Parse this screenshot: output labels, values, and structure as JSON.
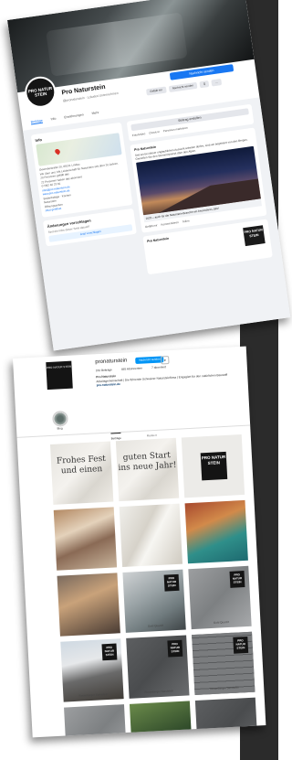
{
  "facebook": {
    "page_name": "Pro Naturstein",
    "handle": "@pronaturstein · Lokales Unternehmen",
    "avatar_text": "PRO NATUR STEIN",
    "primary_button": "Nachricht senden",
    "buttons": [
      "Gefällt mir",
      "Nachricht senden",
      "Q",
      "..."
    ],
    "tabs": [
      "Beiträge",
      "Info",
      "Erwähnungen",
      "Mehr"
    ],
    "info": {
      "heading": "Info",
      "address": "Gewerbestraße 20, 88131 Lindau",
      "lines": [
        "Wir über uns: Mit Leidenschaft für Naturstein seit über 20 Jahren.",
        "20 Personen gefällt das",
        "22 Personen haben das abonniert",
        "07382 40 23 81",
        "info@pro-naturstein.de",
        "www.pro-naturstein.de",
        "Bodenbeläge · Küchen",
        "Naturstein",
        "Öffnungszeiten",
        "Jetzt geöffnet"
      ]
    },
    "suggest_box": {
      "heading": "Änderungen vorschlagen",
      "text": "Sind die Infos dieser Seite aktuell?",
      "button": "Jetzt vorschlagen"
    },
    "post": {
      "create_label": "Beitrag erstellen",
      "actions": [
        "Foto/Video",
        "Check-in",
        "Personen markieren"
      ],
      "author": "Pro Naturstein",
      "text": "Seit wir bei dieser unglaublichen Aussicht arbeiten dürfen, sind wir begeistert von den Bergen. Genießen Sie den Sternenhimmel über den Alpen.",
      "link_text": "2020 – auch für die Naturstein-Branche ein besonderes Jahr!",
      "reactions": [
        "Gefällt mir",
        "Kommentieren",
        "Teilen"
      ]
    },
    "sign_text": "PRO NATUR STEIN"
  },
  "instagram": {
    "username": "pronaturstein",
    "follow_label": "Nachricht senden",
    "chevron": "▾",
    "stats": [
      "162 Beiträge",
      "485 Abonnenten",
      "7 abonniert"
    ],
    "bio_name": "Pro Naturstein",
    "bio_lines": [
      "Arbeitsgemeinschaft | Die führende Schweizer Natursteinfirma | Engagiert für den natürlichen Baustoff",
      "pro-naturstein.de"
    ],
    "highlight_label": "Blog",
    "tabs": [
      "Beiträge",
      "Markiert"
    ],
    "logo_text": "PRO NATUR STEIN",
    "tiles": [
      {
        "type": "marble",
        "script": "Frohes Fest und einen",
        "caption": ""
      },
      {
        "type": "marble",
        "script": "guten Start ins neue Jahr!",
        "caption": ""
      },
      {
        "type": "logo",
        "script": "",
        "caption": ""
      },
      {
        "type": "kitchen",
        "script": "",
        "caption": ""
      },
      {
        "type": "stone",
        "script": "",
        "caption": ""
      },
      {
        "type": "green",
        "script": "",
        "caption": ""
      },
      {
        "type": "bath",
        "script": "",
        "caption": ""
      },
      {
        "type": "terrace",
        "script": "",
        "caption": "Gold Quarzit"
      },
      {
        "type": "grey",
        "script": "",
        "caption": "Gold Quarzit"
      },
      {
        "type": "house",
        "script": "",
        "caption": "Rosenberger Sandstein"
      },
      {
        "type": "slab",
        "script": "",
        "caption": "Rosenberger Sandstein"
      },
      {
        "type": "wall",
        "script": "",
        "caption": "Rosenberger Sandstein"
      },
      {
        "type": "grey",
        "script": "",
        "caption": ""
      },
      {
        "type": "garden",
        "script": "",
        "caption": ""
      },
      {
        "type": "slab",
        "script": "",
        "caption": ""
      }
    ]
  }
}
